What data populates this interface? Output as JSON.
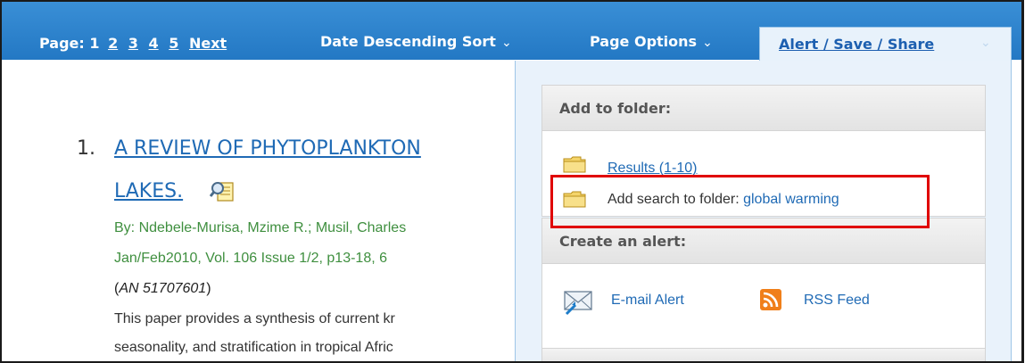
{
  "toolbar": {
    "page_label": "Page: 1",
    "pages": [
      "2",
      "3",
      "4",
      "5"
    ],
    "next_label": "Next",
    "sort_label": "Date Descending Sort",
    "page_options_label": "Page Options",
    "alert_save_share_label": "Alert / Save / Share"
  },
  "result": {
    "number": "1.",
    "title_line1": "A REVIEW OF PHYTOPLANKTON",
    "title_line2": "LAKES.",
    "byline": "By: Ndebele-Murisa, Mzime R.; Musil, Charles",
    "citation": "Jan/Feb2010, Vol. 106 Issue 1/2, p13-18, 6",
    "an_open": "(",
    "an_value": "AN 51707601",
    "an_close": ")",
    "abstract_line1": "This paper provides a synthesis of current kr",
    "abstract_line2": "seasonality, and stratification in tropical Afric"
  },
  "dropdown": {
    "add_to_folder_header": "Add to folder:",
    "results_item": "Results (1-10)",
    "add_search_label": "Add search to folder: ",
    "add_search_value": "global warming",
    "create_alert_header": "Create an alert:",
    "email_alert": "E-mail Alert",
    "rss_feed": "RSS Feed"
  },
  "colors": {
    "toolbar_blue": "#2378c4",
    "link_blue": "#1f6ab5",
    "meta_green": "#3f8f3f",
    "highlight_red": "#e00000",
    "rss_orange": "#f07f1a"
  },
  "icons": [
    "chevron-down-icon",
    "preview-icon",
    "folder-icon",
    "email-alert-icon",
    "rss-icon"
  ]
}
